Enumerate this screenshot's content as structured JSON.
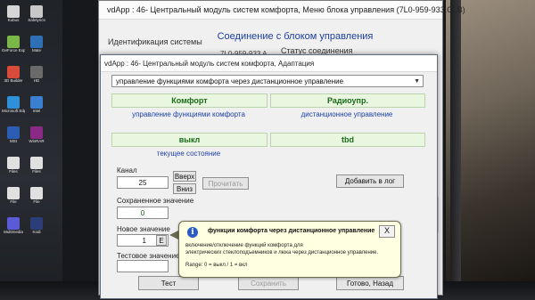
{
  "desktop": {
    "icons": [
      {
        "label": "Kubus",
        "color": "#d6d6d6"
      },
      {
        "label": "Safelyrics",
        "color": "#c8c8c8"
      },
      {
        "label": "GeForce Experience",
        "color": "#7ab648"
      },
      {
        "label": "Mate",
        "color": "#2f6fb5"
      },
      {
        "label": "3D Builder",
        "color": "#d84a3a"
      },
      {
        "label": "HD",
        "color": "#6a6a6a"
      },
      {
        "label": "Microsoft Edge",
        "color": "#2f8fd8"
      },
      {
        "label": "Intel",
        "color": "#3b7fd0"
      },
      {
        "label": "MSI",
        "color": "#2b5db5"
      },
      {
        "label": "WinRAR",
        "color": "#8a2a84"
      },
      {
        "label": "Files",
        "color": "#e0e0e0"
      },
      {
        "label": "Files",
        "color": "#e0e0e0"
      },
      {
        "label": "File",
        "color": "#e0e0e0"
      },
      {
        "label": "File",
        "color": "#e0e0e0"
      },
      {
        "label": "Multimedia",
        "color": "#5b5bd8"
      },
      {
        "label": "Kodi",
        "color": "#2c3e7a"
      }
    ]
  },
  "back_window": {
    "title": "vdApp : 46- Центральный модуль систем комфорта,  Меню блока управления (7L0-959-933.CLB)",
    "heading": "Соединение с блоком управления",
    "ident_label": "Идентификация системы",
    "ident_value": "7L0-959-933 A",
    "status_label": "Статус соединения",
    "status_value": "...",
    "icon": "app-icon"
  },
  "front_window": {
    "title": "vdApp : 46- Центральный модуль систем комфорта, Адаптация",
    "select_value": "управление функциями комфорта через дистанционное управление",
    "group1": {
      "left_value": "Комфорт",
      "left_label": "управление функциями комфорта",
      "right_value": "Радиоупр.",
      "right_label": "дистанционное управление"
    },
    "group2": {
      "left_value": "выкл",
      "left_label": "текущее состояние",
      "right_value": "tbd"
    },
    "channel_label": "Канал",
    "channel_value": "25",
    "up_button": "Вверх",
    "down_button": "Вниз",
    "read_button": "Прочитать",
    "log_button": "Добавить в лог",
    "saved_label": "Сохраненное значение",
    "saved_value": "0",
    "new_label": "Новое значение",
    "new_value": "1",
    "e_button": "E",
    "test_label": "Тестовое значение",
    "test_value": "",
    "test_button": "Тест",
    "save_button": "Сохранить",
    "done_button": "Готово, Назад"
  },
  "tooltip": {
    "title": "функции комфорта через дистанционное управление",
    "line1": "включение/отключение функций комфорта для",
    "line2": "электрических стеклоподъемников и люка через дистанционное управление.",
    "range": "Range: 0 = выкл / 1 = вкл",
    "close": "X",
    "icon": "info-icon"
  },
  "colors": {
    "green_text": "#1a6b1a",
    "blue_text": "#1c3fa8",
    "tooltip_bg": "#ffffe1"
  }
}
